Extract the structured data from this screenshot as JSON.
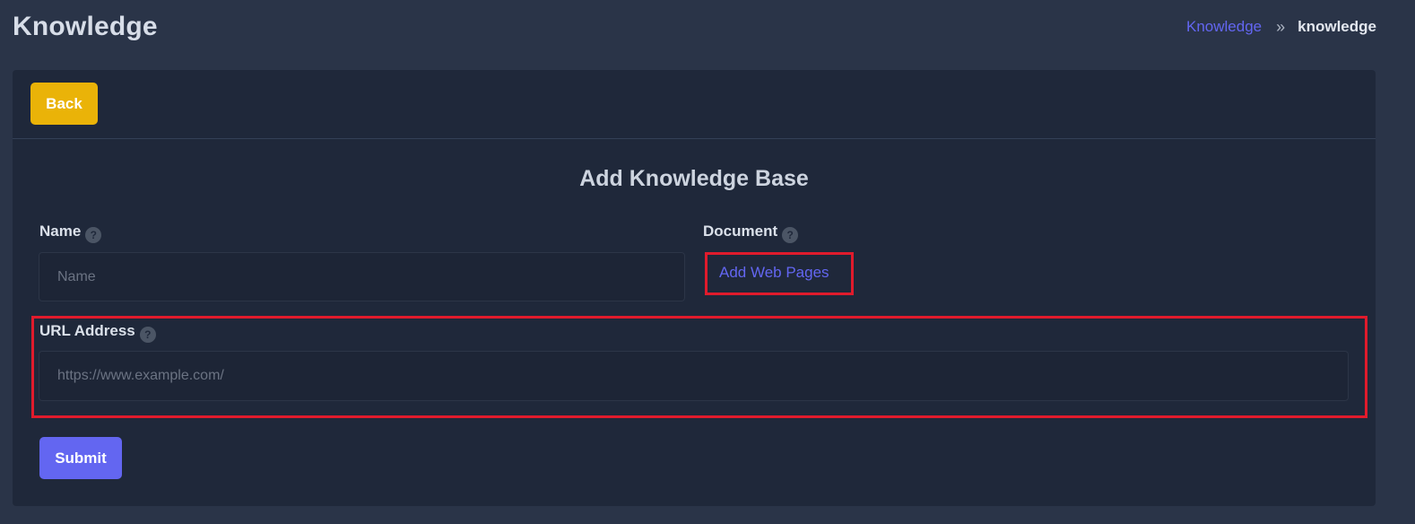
{
  "header": {
    "title": "Knowledge",
    "breadcrumb": {
      "link": "Knowledge",
      "separator": "»",
      "current": "knowledge"
    }
  },
  "toolbar": {
    "back_label": "Back"
  },
  "form": {
    "title": "Add Knowledge Base",
    "name": {
      "label": "Name",
      "placeholder": "Name",
      "value": ""
    },
    "document": {
      "label": "Document",
      "add_web_pages_label": "Add Web Pages"
    },
    "url": {
      "label": "URL Address",
      "placeholder": "https://www.example.com/",
      "value": ""
    },
    "help_icon_glyph": "?",
    "submit_label": "Submit"
  },
  "icons": {
    "help": "question-circle-icon",
    "breadcrumb_separator": "double-chevron-right-icon"
  },
  "colors": {
    "background": "#2a3448",
    "card": "#1f283a",
    "accent": "#6366f1",
    "back_button": "#eab308",
    "highlight": "#e01b2c"
  }
}
